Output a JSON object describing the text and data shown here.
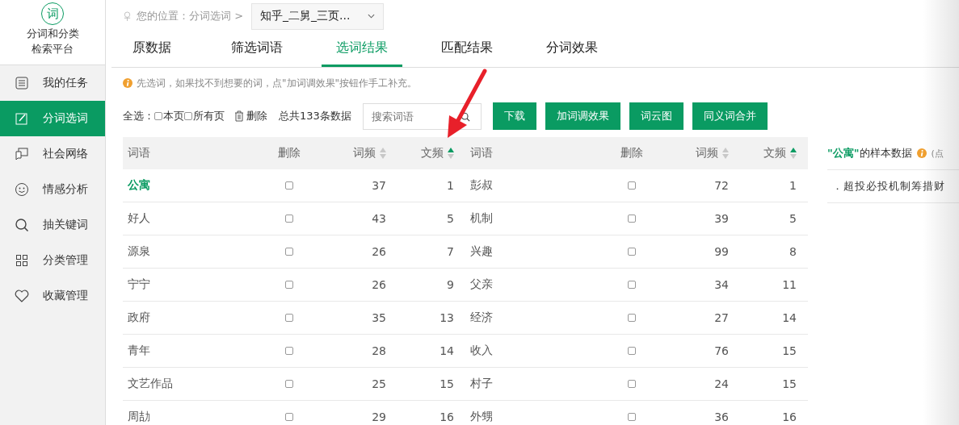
{
  "sidebar": {
    "logo": "词",
    "title_lines": [
      "分词和分类",
      "检索平台"
    ],
    "items": [
      {
        "label": "我的任务",
        "selected": false
      },
      {
        "label": "分词选词",
        "selected": true
      },
      {
        "label": "社会网络",
        "selected": false
      },
      {
        "label": "情感分析",
        "selected": false
      },
      {
        "label": "抽关键词",
        "selected": false
      },
      {
        "label": "分类管理",
        "selected": false
      },
      {
        "label": "收藏管理",
        "selected": false
      }
    ]
  },
  "breadcrumb": {
    "label": "您的位置：分词选词 >",
    "dropdown": "知乎_二舅_三页..."
  },
  "tabs": [
    {
      "label": "原数据",
      "selected": false
    },
    {
      "label": "筛选词语",
      "selected": false
    },
    {
      "label": "选词结果",
      "selected": true
    },
    {
      "label": "匹配结果",
      "selected": false
    },
    {
      "label": "分词效果",
      "selected": false
    }
  ],
  "notice": "先选词，如果找不到想要的词，点\"加词调效果\"按钮作手工补充。",
  "toolbar": {
    "select_all_label": "全选：",
    "options": [
      {
        "label": "本页",
        "checked": false
      },
      {
        "label": "所有页",
        "checked": false
      }
    ],
    "delete_label": "删除",
    "total": "总共133条数据",
    "search": {
      "placeholder": "搜索词语"
    },
    "buttons": [
      "下载",
      "加词调效果",
      "词云图",
      "同义词合并"
    ]
  },
  "tables": [
    {
      "columns": [
        {
          "label": "词语",
          "kind": "text"
        },
        {
          "label": "删除",
          "kind": "check"
        },
        {
          "label": "词频",
          "kind": "number",
          "sort_active": false
        },
        {
          "label": "文频",
          "kind": "number",
          "sort_active": true
        }
      ],
      "rows": [
        {
          "word": "公寓",
          "checked": false,
          "tf": "37",
          "df": "1",
          "selected": true
        },
        {
          "word": "好人",
          "checked": false,
          "tf": "43",
          "df": "5",
          "selected": false
        },
        {
          "word": "源泉",
          "checked": false,
          "tf": "26",
          "df": "7",
          "selected": false
        },
        {
          "word": "宁宁",
          "checked": false,
          "tf": "26",
          "df": "9",
          "selected": false
        },
        {
          "word": "政府",
          "checked": false,
          "tf": "35",
          "df": "13",
          "selected": false
        },
        {
          "word": "青年",
          "checked": false,
          "tf": "28",
          "df": "14",
          "selected": false
        },
        {
          "word": "文艺作品",
          "checked": false,
          "tf": "25",
          "df": "15",
          "selected": false
        },
        {
          "word": "周劼",
          "checked": false,
          "tf": "29",
          "df": "16",
          "selected": false
        }
      ]
    },
    {
      "columns": [
        {
          "label": "词语",
          "kind": "text"
        },
        {
          "label": "删除",
          "kind": "check"
        },
        {
          "label": "词频",
          "kind": "number",
          "sort_active": false
        },
        {
          "label": "文频",
          "kind": "number",
          "sort_active": true
        }
      ],
      "rows": [
        {
          "word": "彭叔",
          "checked": false,
          "tf": "72",
          "df": "1",
          "selected": false
        },
        {
          "word": "机制",
          "checked": false,
          "tf": "39",
          "df": "5",
          "selected": false
        },
        {
          "word": "兴趣",
          "checked": false,
          "tf": "99",
          "df": "8",
          "selected": false
        },
        {
          "word": "父亲",
          "checked": false,
          "tf": "34",
          "df": "11",
          "selected": false
        },
        {
          "word": "经济",
          "checked": false,
          "tf": "27",
          "df": "14",
          "selected": false
        },
        {
          "word": "收入",
          "checked": false,
          "tf": "76",
          "df": "15",
          "selected": false
        },
        {
          "word": "村子",
          "checked": false,
          "tf": "24",
          "df": "15",
          "selected": false
        },
        {
          "word": "外甥",
          "checked": false,
          "tf": "36",
          "df": "16",
          "selected": false
        }
      ]
    }
  ],
  "sample_panel": {
    "title": "**\"公寓\"**的样本数据",
    "hint": "(点",
    "items": [
      "．超投必投机制筹措财"
    ]
  }
}
